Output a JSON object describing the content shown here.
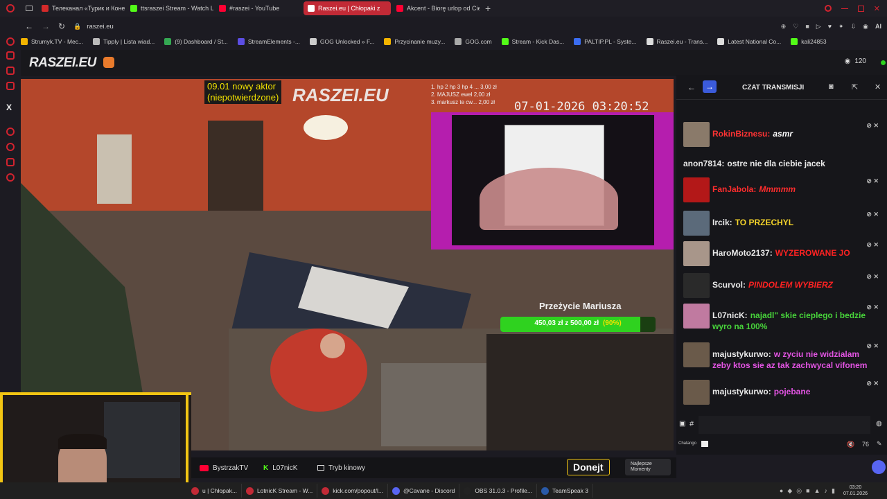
{
  "tabs": [
    {
      "label": "Телеканал «Турик и Коне",
      "color": "#d42a2a"
    },
    {
      "label": "ttsraszei Stream - Watch Li",
      "color": "#53fc18"
    },
    {
      "label": "#raszei - YouTube",
      "color": "#ff0033"
    },
    {
      "label": "Raszei.eu | Chłopaki z",
      "color": "#ffffff",
      "active": true
    },
    {
      "label": "Akcent - Biorę urlop od Cie",
      "color": "#ff0033"
    }
  ],
  "address": "raszei.eu",
  "address_right": "AI",
  "bookmarks": [
    {
      "label": "Strumyk.TV - Mec...",
      "color": "#f4b400"
    },
    {
      "label": "Tipply | Lista wiad...",
      "color": "#bbbbbb"
    },
    {
      "label": "(9) Dashboard / St...",
      "color": "#34a853"
    },
    {
      "label": "StreamElements -...",
      "color": "#5c4ee5"
    },
    {
      "label": "GOG Unlocked » F...",
      "color": "#cccccc"
    },
    {
      "label": "Przycinanie muzy...",
      "color": "#f4b400"
    },
    {
      "label": "GOG.com",
      "color": "#aaaaaa"
    },
    {
      "label": "Stream - Kick Das...",
      "color": "#53fc18"
    },
    {
      "label": "PALTIP.PL - Syste...",
      "color": "#3b6df2"
    },
    {
      "label": "Raszei.eu - Trans...",
      "color": "#dddddd"
    },
    {
      "label": "Latest National Co...",
      "color": "#dddddd"
    },
    {
      "label": "kali24853",
      "color": "#53fc18"
    }
  ],
  "site": {
    "logo": "RASZEI.EU",
    "viewers": "120"
  },
  "video": {
    "overlay_note": "09.01 nowy aktor (niepotwierdzone)",
    "overlay_note_l1": "09.01 nowy aktor",
    "overlay_note_l2": "(niepotwierdzone)",
    "watermark": "RASZEI.EU",
    "timestamp": "07-01-2026 03:20:52",
    "donors": [
      "1. hp 2 hp 3 hp 4 ... 3,00 zł",
      "2. MAJUSZ ewel 2,00 zł",
      "3. markusz te cw... 2,00 zł"
    ],
    "goal_title": "Przeżycie Mariusza",
    "goal_text": "450,03 zł z 500,00 zł",
    "goal_percent": "(90%)",
    "goal_fraction": 0.9
  },
  "chat": {
    "title": "CZAT TRANSMISJI",
    "messages": [
      {
        "user": "RokinBiznesu:",
        "text": "asmr",
        "user_color": "#ff3333",
        "text_color": "#ffffff",
        "italic": true
      },
      {
        "user": "anon7814:",
        "text": "ostre nie dla ciebie jacek",
        "user_color": "#e9e9e9",
        "text_color": "#e9e9e9",
        "italic": false
      },
      {
        "user": "FanJabola:",
        "text": "Mmmmm",
        "user_color": "#ff2d2d",
        "text_color": "#ff2d2d",
        "italic": true
      },
      {
        "user": "Ircik:",
        "text": "TO PRZECHYL",
        "user_color": "#e9e9e9",
        "text_color": "#f5d42a",
        "italic": false
      },
      {
        "user": "HaroMoto2137:",
        "text": "WYZEROWANE JO",
        "user_color": "#e9e9e9",
        "text_color": "#ff2222",
        "italic": false
      },
      {
        "user": "Scurvol:",
        "text": "PINDOLEM WYBIERZ",
        "user_color": "#e9e9e9",
        "text_color": "#ff2222",
        "italic": true
      },
      {
        "user": "L07nicK:",
        "text": "najadl\" skie cieplego i bedzie wyro na 100%",
        "user_color": "#e9e9e9",
        "text_color": "#47d23a",
        "italic": false
      },
      {
        "user": "majustykurwo:",
        "text": "w zyciu nie widzialam zeby ktos sie az tak zachwycal vifonem",
        "user_color": "#e9e9e9",
        "text_color": "#e254e2",
        "italic": false
      },
      {
        "user": "majustykurwo:",
        "text": "pojebane",
        "user_color": "#e9e9e9",
        "text_color": "#e254e2",
        "italic": false
      }
    ],
    "input_hash": "#",
    "footer_label": "Chatango",
    "volume": "76"
  },
  "bottom": {
    "btn1": "BystrzakTV",
    "btn2": "L07nicK",
    "btn3": "Tryb kinowy",
    "donate": "Donejt",
    "best": "Najlepsze Momenty"
  },
  "taskbar": {
    "items": [
      {
        "label": "u | Chłopak...",
        "color": "#c22a36"
      },
      {
        "label": "LotnicK Stream - W...",
        "color": "#c22a36"
      },
      {
        "label": "kick.com/popout/l...",
        "color": "#c22a36"
      },
      {
        "label": "@Cavane - Discord",
        "color": "#5865f2"
      },
      {
        "label": "OBS 31.0.3 - Profile...",
        "color": "#222222"
      },
      {
        "label": "TeamSpeak 3",
        "color": "#2a5aa8"
      }
    ],
    "time": "03:20",
    "date": "07.01.2026"
  },
  "colors": {
    "accent": "#c22a36",
    "gold": "#f2c513",
    "goal_green": "#2fd21f"
  }
}
